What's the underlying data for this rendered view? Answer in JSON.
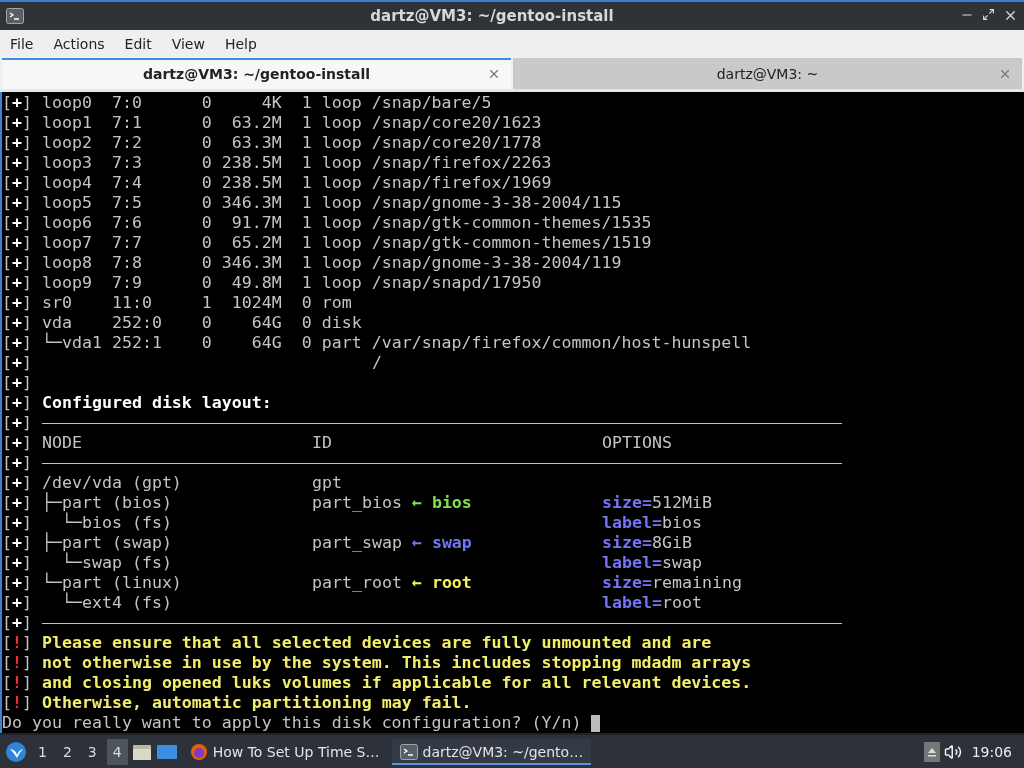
{
  "window": {
    "title": "dartz@VM3: ~/gentoo-install"
  },
  "menu": [
    "File",
    "Actions",
    "Edit",
    "View",
    "Help"
  ],
  "tabs": [
    {
      "label": "dartz@VM3: ~/gentoo-install",
      "selected": true
    },
    {
      "label": "dartz@VM3: ~",
      "selected": false
    }
  ],
  "terminal": {
    "lines": [
      {
        "marker": {
          "text": "[+]",
          "color": "#ffffff"
        },
        "kind": "text",
        "segments": [
          {
            "text": "loop0  7:0      0     4K  1 loop /snap/bare/5",
            "kind": "plain"
          }
        ]
      },
      {
        "marker": {
          "text": "[+]",
          "color": "#ffffff"
        },
        "kind": "text",
        "segments": [
          {
            "text": "loop1  7:1      0  63.2M  1 loop /snap/core20/1623",
            "kind": "plain"
          }
        ]
      },
      {
        "marker": {
          "text": "[+]",
          "color": "#ffffff"
        },
        "kind": "text",
        "segments": [
          {
            "text": "loop2  7:2      0  63.3M  1 loop /snap/core20/1778",
            "kind": "plain"
          }
        ]
      },
      {
        "marker": {
          "text": "[+]",
          "color": "#ffffff"
        },
        "kind": "text",
        "segments": [
          {
            "text": "loop3  7:3      0 238.5M  1 loop /snap/firefox/2263",
            "kind": "plain"
          }
        ]
      },
      {
        "marker": {
          "text": "[+]",
          "color": "#ffffff"
        },
        "kind": "text",
        "segments": [
          {
            "text": "loop4  7:4      0 238.5M  1 loop /snap/firefox/1969",
            "kind": "plain"
          }
        ]
      },
      {
        "marker": {
          "text": "[+]",
          "color": "#ffffff"
        },
        "kind": "text",
        "segments": [
          {
            "text": "loop5  7:5      0 346.3M  1 loop /snap/gnome-3-38-2004/115",
            "kind": "plain"
          }
        ]
      },
      {
        "marker": {
          "text": "[+]",
          "color": "#ffffff"
        },
        "kind": "text",
        "segments": [
          {
            "text": "loop6  7:6      0  91.7M  1 loop /snap/gtk-common-themes/1535",
            "kind": "plain"
          }
        ]
      },
      {
        "marker": {
          "text": "[+]",
          "color": "#ffffff"
        },
        "kind": "text",
        "segments": [
          {
            "text": "loop7  7:7      0  65.2M  1 loop /snap/gtk-common-themes/1519",
            "kind": "plain"
          }
        ]
      },
      {
        "marker": {
          "text": "[+]",
          "color": "#ffffff"
        },
        "kind": "text",
        "segments": [
          {
            "text": "loop8  7:8      0 346.3M  1 loop /snap/gnome-3-38-2004/119",
            "kind": "plain"
          }
        ]
      },
      {
        "marker": {
          "text": "[+]",
          "color": "#ffffff"
        },
        "kind": "text",
        "segments": [
          {
            "text": "loop9  7:9      0  49.8M  1 loop /snap/snapd/17950",
            "kind": "plain"
          }
        ]
      },
      {
        "marker": {
          "text": "[+]",
          "color": "#ffffff"
        },
        "kind": "text",
        "segments": [
          {
            "text": "sr0    11:0     1  1024M  0 rom",
            "kind": "plain"
          }
        ]
      },
      {
        "marker": {
          "text": "[+]",
          "color": "#ffffff"
        },
        "kind": "text",
        "segments": [
          {
            "text": "vda    252:0    0    64G  0 disk",
            "kind": "plain"
          }
        ]
      },
      {
        "marker": {
          "text": "[+]",
          "color": "#ffffff"
        },
        "kind": "text",
        "segments": [
          {
            "text": "└─vda1 252:1    0    64G  0 part /var/snap/firefox/common/host-hunspell",
            "kind": "plain"
          }
        ]
      },
      {
        "marker": {
          "text": "[+]",
          "color": "#ffffff"
        },
        "kind": "indented",
        "segments": [
          {
            "text": "/",
            "kind": "plain"
          }
        ]
      },
      {
        "marker": {
          "text": "[+]",
          "color": "#ffffff"
        },
        "kind": "blank"
      },
      {
        "marker": {
          "text": "[+]",
          "color": "#ffffff"
        },
        "kind": "text",
        "segments": [
          {
            "text": "Configured disk layout:",
            "kind": "bold"
          }
        ]
      },
      {
        "marker": {
          "text": "[+]",
          "color": "#ffffff"
        },
        "kind": "rule"
      },
      {
        "marker": {
          "text": "[+]",
          "color": "#ffffff"
        },
        "kind": "table",
        "cells": [
          [
            {
              "text": "NODE",
              "kind": "plain"
            }
          ],
          [
            {
              "text": "ID",
              "kind": "plain"
            }
          ],
          [
            {
              "text": "OPTIONS",
              "kind": "plain"
            }
          ]
        ]
      },
      {
        "marker": {
          "text": "[+]",
          "color": "#ffffff"
        },
        "kind": "rule"
      },
      {
        "marker": {
          "text": "[+]",
          "color": "#ffffff"
        },
        "kind": "table",
        "cells": [
          [
            {
              "text": "/dev/vda (gpt)",
              "kind": "plain"
            }
          ],
          [
            {
              "text": "gpt",
              "kind": "plain"
            }
          ],
          []
        ]
      },
      {
        "marker": {
          "text": "[+]",
          "color": "#ffffff"
        },
        "kind": "table",
        "cells": [
          [
            {
              "text": "├─part (bios)",
              "kind": "plain"
            }
          ],
          [
            {
              "text": "part_bios",
              "kind": "plain"
            },
            {
              "text": " ← bios",
              "kind": "green"
            }
          ],
          [
            {
              "text": "size=",
              "kind": "key"
            },
            {
              "text": "512MiB",
              "kind": "plain"
            }
          ]
        ]
      },
      {
        "marker": {
          "text": "[+]",
          "color": "#ffffff"
        },
        "kind": "table",
        "cells": [
          [
            {
              "text": "  └─bios (fs)",
              "kind": "plain"
            }
          ],
          [],
          [
            {
              "text": "label=",
              "kind": "key"
            },
            {
              "text": "bios",
              "kind": "plain"
            }
          ]
        ]
      },
      {
        "marker": {
          "text": "[+]",
          "color": "#ffffff"
        },
        "kind": "table",
        "cells": [
          [
            {
              "text": "├─part (swap)",
              "kind": "plain"
            }
          ],
          [
            {
              "text": "part_swap",
              "kind": "plain"
            },
            {
              "text": " ← swap",
              "kind": "blue"
            }
          ],
          [
            {
              "text": "size=",
              "kind": "key"
            },
            {
              "text": "8GiB",
              "kind": "plain"
            }
          ]
        ]
      },
      {
        "marker": {
          "text": "[+]",
          "color": "#ffffff"
        },
        "kind": "table",
        "cells": [
          [
            {
              "text": "  └─swap (fs)",
              "kind": "plain"
            }
          ],
          [],
          [
            {
              "text": "label=",
              "kind": "key"
            },
            {
              "text": "swap",
              "kind": "plain"
            }
          ]
        ]
      },
      {
        "marker": {
          "text": "[+]",
          "color": "#ffffff"
        },
        "kind": "table",
        "cells": [
          [
            {
              "text": "└─part (linux)",
              "kind": "plain"
            }
          ],
          [
            {
              "text": "part_root",
              "kind": "plain"
            },
            {
              "text": " ← root",
              "kind": "yellow"
            }
          ],
          [
            {
              "text": "size=",
              "kind": "key"
            },
            {
              "text": "remaining",
              "kind": "plain"
            }
          ]
        ]
      },
      {
        "marker": {
          "text": "[+]",
          "color": "#ffffff"
        },
        "kind": "table",
        "cells": [
          [
            {
              "text": "  └─ext4 (fs)",
              "kind": "plain"
            }
          ],
          [],
          [
            {
              "text": "label=",
              "kind": "key"
            },
            {
              "text": "root",
              "kind": "plain"
            }
          ]
        ]
      },
      {
        "marker": {
          "text": "[+]",
          "color": "#ffffff"
        },
        "kind": "rule"
      },
      {
        "marker": {
          "text": "[!]",
          "color": "#ef3030"
        },
        "kind": "text",
        "segments": [
          {
            "text": "Please ensure that all selected devices are fully unmounted and are",
            "kind": "warning"
          }
        ]
      },
      {
        "marker": {
          "text": "[!]",
          "color": "#ef3030"
        },
        "kind": "text",
        "segments": [
          {
            "text": "not otherwise in use by the system. This includes stopping mdadm arrays",
            "kind": "warning"
          }
        ]
      },
      {
        "marker": {
          "text": "[!]",
          "color": "#ef3030"
        },
        "kind": "text",
        "segments": [
          {
            "text": "and closing opened luks volumes if applicable for all relevant devices.",
            "kind": "warning"
          }
        ]
      },
      {
        "marker": {
          "text": "[!]",
          "color": "#ef3030"
        },
        "kind": "text",
        "segments": [
          {
            "text": "Otherwise, automatic partitioning may fail.",
            "kind": "warning"
          }
        ]
      }
    ],
    "prompt": "Do you really want to apply this disk configuration? (Y/n)"
  },
  "taskbar": {
    "workspaces": [
      {
        "label": "1",
        "selected": false
      },
      {
        "label": "2",
        "selected": false
      },
      {
        "label": "3",
        "selected": false
      },
      {
        "label": "4",
        "selected": true
      }
    ],
    "tasks": [
      {
        "label": "How To Set Up Time S…",
        "kind": "browser",
        "selected": false
      },
      {
        "label": "dartz@VM3: ~/gento…",
        "kind": "terminal",
        "selected": true
      }
    ],
    "clock": "19:06"
  }
}
